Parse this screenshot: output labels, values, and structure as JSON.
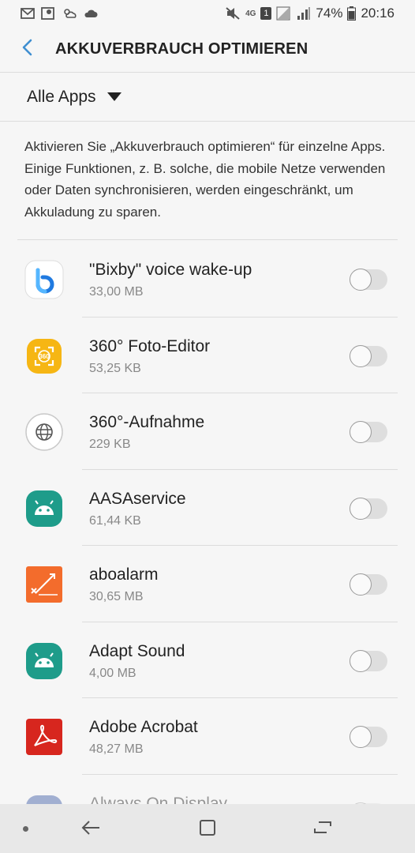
{
  "status_bar": {
    "network": "4G",
    "sim": "1",
    "battery": "74%",
    "time": "20:16"
  },
  "app_bar": {
    "title": "AKKUVERBRAUCH OPTIMIEREN"
  },
  "filter": {
    "label": "Alle Apps"
  },
  "description": "Aktivieren Sie „Akkuverbrauch optimieren“ für einzelne Apps. Einige Funktionen, z. B. solche, die mobile Netze verwenden oder Daten synchronisieren, werden eingeschränkt, um Akkuladung zu sparen.",
  "apps": [
    {
      "name": "\"Bixby\" voice wake-up",
      "size": "33,00 MB",
      "icon": "bixby-icon"
    },
    {
      "name": "360° Foto-Editor",
      "size": "53,25 KB",
      "icon": "photo-editor-360-icon",
      "icon_text": "360"
    },
    {
      "name": "360°-Aufnahme",
      "size": "229 KB",
      "icon": "globe-360-icon"
    },
    {
      "name": "AASAservice",
      "size": "61,44 KB",
      "icon": "android-icon"
    },
    {
      "name": "aboalarm",
      "size": "30,65 MB",
      "icon": "aboalarm-icon"
    },
    {
      "name": "Adapt Sound",
      "size": "4,00 MB",
      "icon": "android-icon"
    },
    {
      "name": "Adobe Acrobat",
      "size": "48,27 MB",
      "icon": "acrobat-icon"
    },
    {
      "name": "Always On Display",
      "size": "",
      "icon": "always-on-display-icon"
    }
  ],
  "colors": {
    "accent": "#3f8fd1",
    "android_teal": "#1e9c8a",
    "acrobat_red": "#d7261e",
    "aboalarm_orange": "#f36c2c",
    "photo_yellow": "#f6b614"
  }
}
